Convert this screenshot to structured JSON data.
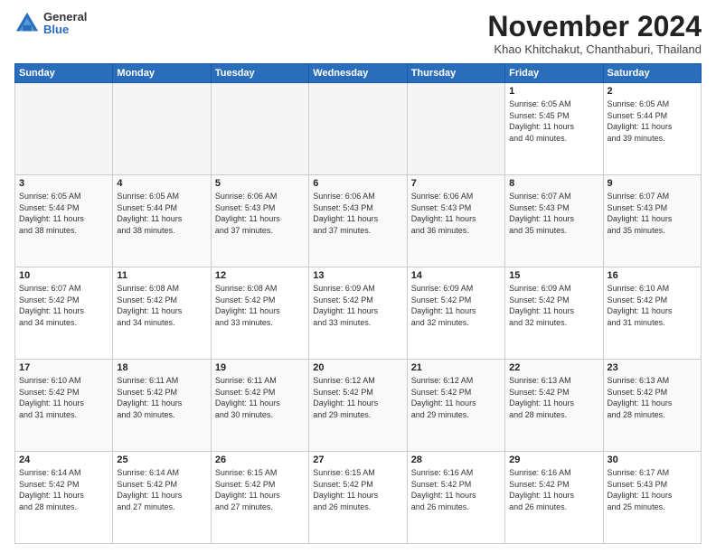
{
  "logo": {
    "general": "General",
    "blue": "Blue"
  },
  "header": {
    "month": "November 2024",
    "location": "Khao Khitchakut, Chanthaburi, Thailand"
  },
  "weekdays": [
    "Sunday",
    "Monday",
    "Tuesday",
    "Wednesday",
    "Thursday",
    "Friday",
    "Saturday"
  ],
  "weeks": [
    [
      {
        "day": "",
        "info": ""
      },
      {
        "day": "",
        "info": ""
      },
      {
        "day": "",
        "info": ""
      },
      {
        "day": "",
        "info": ""
      },
      {
        "day": "",
        "info": ""
      },
      {
        "day": "1",
        "info": "Sunrise: 6:05 AM\nSunset: 5:45 PM\nDaylight: 11 hours\nand 40 minutes."
      },
      {
        "day": "2",
        "info": "Sunrise: 6:05 AM\nSunset: 5:44 PM\nDaylight: 11 hours\nand 39 minutes."
      }
    ],
    [
      {
        "day": "3",
        "info": "Sunrise: 6:05 AM\nSunset: 5:44 PM\nDaylight: 11 hours\nand 38 minutes."
      },
      {
        "day": "4",
        "info": "Sunrise: 6:05 AM\nSunset: 5:44 PM\nDaylight: 11 hours\nand 38 minutes."
      },
      {
        "day": "5",
        "info": "Sunrise: 6:06 AM\nSunset: 5:43 PM\nDaylight: 11 hours\nand 37 minutes."
      },
      {
        "day": "6",
        "info": "Sunrise: 6:06 AM\nSunset: 5:43 PM\nDaylight: 11 hours\nand 37 minutes."
      },
      {
        "day": "7",
        "info": "Sunrise: 6:06 AM\nSunset: 5:43 PM\nDaylight: 11 hours\nand 36 minutes."
      },
      {
        "day": "8",
        "info": "Sunrise: 6:07 AM\nSunset: 5:43 PM\nDaylight: 11 hours\nand 35 minutes."
      },
      {
        "day": "9",
        "info": "Sunrise: 6:07 AM\nSunset: 5:43 PM\nDaylight: 11 hours\nand 35 minutes."
      }
    ],
    [
      {
        "day": "10",
        "info": "Sunrise: 6:07 AM\nSunset: 5:42 PM\nDaylight: 11 hours\nand 34 minutes."
      },
      {
        "day": "11",
        "info": "Sunrise: 6:08 AM\nSunset: 5:42 PM\nDaylight: 11 hours\nand 34 minutes."
      },
      {
        "day": "12",
        "info": "Sunrise: 6:08 AM\nSunset: 5:42 PM\nDaylight: 11 hours\nand 33 minutes."
      },
      {
        "day": "13",
        "info": "Sunrise: 6:09 AM\nSunset: 5:42 PM\nDaylight: 11 hours\nand 33 minutes."
      },
      {
        "day": "14",
        "info": "Sunrise: 6:09 AM\nSunset: 5:42 PM\nDaylight: 11 hours\nand 32 minutes."
      },
      {
        "day": "15",
        "info": "Sunrise: 6:09 AM\nSunset: 5:42 PM\nDaylight: 11 hours\nand 32 minutes."
      },
      {
        "day": "16",
        "info": "Sunrise: 6:10 AM\nSunset: 5:42 PM\nDaylight: 11 hours\nand 31 minutes."
      }
    ],
    [
      {
        "day": "17",
        "info": "Sunrise: 6:10 AM\nSunset: 5:42 PM\nDaylight: 11 hours\nand 31 minutes."
      },
      {
        "day": "18",
        "info": "Sunrise: 6:11 AM\nSunset: 5:42 PM\nDaylight: 11 hours\nand 30 minutes."
      },
      {
        "day": "19",
        "info": "Sunrise: 6:11 AM\nSunset: 5:42 PM\nDaylight: 11 hours\nand 30 minutes."
      },
      {
        "day": "20",
        "info": "Sunrise: 6:12 AM\nSunset: 5:42 PM\nDaylight: 11 hours\nand 29 minutes."
      },
      {
        "day": "21",
        "info": "Sunrise: 6:12 AM\nSunset: 5:42 PM\nDaylight: 11 hours\nand 29 minutes."
      },
      {
        "day": "22",
        "info": "Sunrise: 6:13 AM\nSunset: 5:42 PM\nDaylight: 11 hours\nand 28 minutes."
      },
      {
        "day": "23",
        "info": "Sunrise: 6:13 AM\nSunset: 5:42 PM\nDaylight: 11 hours\nand 28 minutes."
      }
    ],
    [
      {
        "day": "24",
        "info": "Sunrise: 6:14 AM\nSunset: 5:42 PM\nDaylight: 11 hours\nand 28 minutes."
      },
      {
        "day": "25",
        "info": "Sunrise: 6:14 AM\nSunset: 5:42 PM\nDaylight: 11 hours\nand 27 minutes."
      },
      {
        "day": "26",
        "info": "Sunrise: 6:15 AM\nSunset: 5:42 PM\nDaylight: 11 hours\nand 27 minutes."
      },
      {
        "day": "27",
        "info": "Sunrise: 6:15 AM\nSunset: 5:42 PM\nDaylight: 11 hours\nand 26 minutes."
      },
      {
        "day": "28",
        "info": "Sunrise: 6:16 AM\nSunset: 5:42 PM\nDaylight: 11 hours\nand 26 minutes."
      },
      {
        "day": "29",
        "info": "Sunrise: 6:16 AM\nSunset: 5:42 PM\nDaylight: 11 hours\nand 26 minutes."
      },
      {
        "day": "30",
        "info": "Sunrise: 6:17 AM\nSunset: 5:43 PM\nDaylight: 11 hours\nand 25 minutes."
      }
    ]
  ]
}
